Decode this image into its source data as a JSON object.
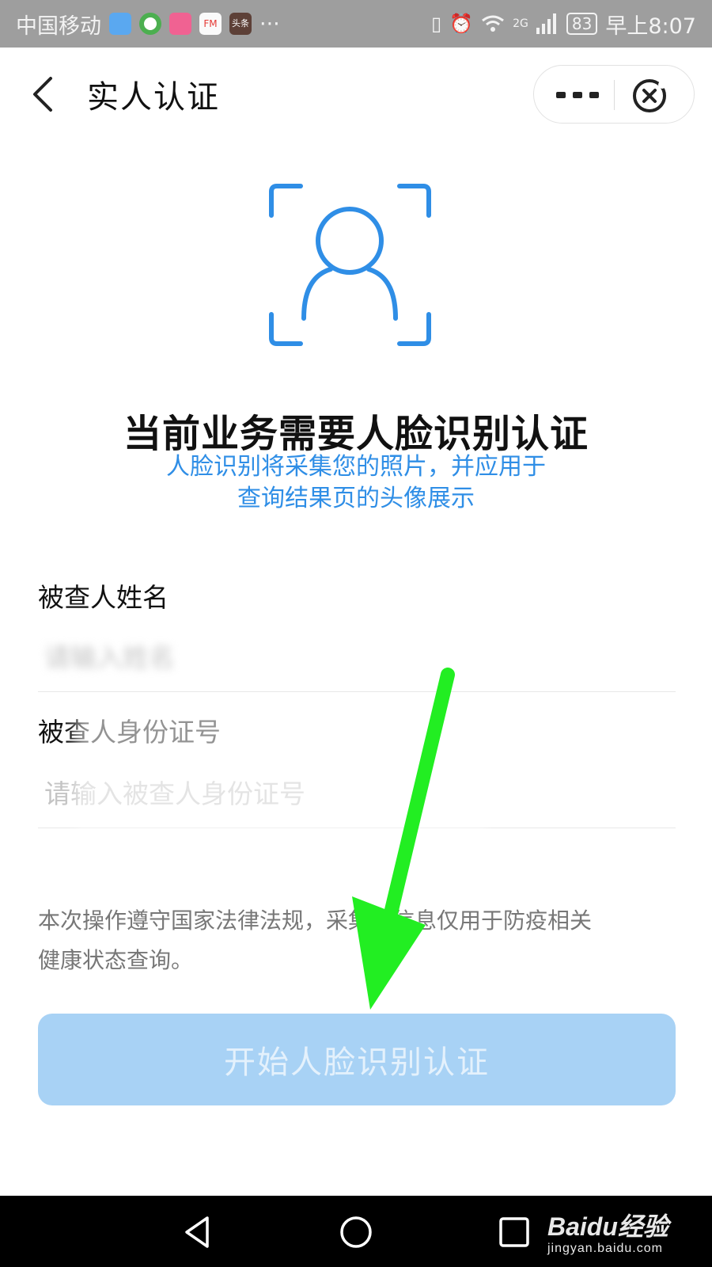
{
  "status_bar": {
    "carrier": "中国移动",
    "more": "···",
    "network": "2G",
    "battery": "83",
    "time": "早上8:07",
    "app_icons": [
      "app-icon-1",
      "app-icon-2",
      "app-icon-3",
      "fm-icon",
      "news-icon"
    ]
  },
  "header": {
    "title": "实人认证"
  },
  "face_section": {
    "title": "当前业务需要人脸识别认证",
    "subtitle_line1": "人脸识别将采集您的照片，并应用于",
    "subtitle_line2": "查询结果页的头像展示"
  },
  "form": {
    "name_label": "被查人姓名",
    "name_placeholder": "请输入姓名",
    "id_label": "被查人身份证号",
    "id_placeholder": "请输入被查人身份证号"
  },
  "notice_line1": "本次操作遵守国家法律法规，采集的信息仅用于防疫相关",
  "notice_line2": "健康状态查询。",
  "start_button_label": "开始人脸识别认证",
  "watermark": {
    "brand": "Baidu经验",
    "url": "jingyan.baidu.com"
  },
  "colors": {
    "accent": "#2f8ee6",
    "button_disabled": "#a8d2f5",
    "annotation_arrow": "#22ee22"
  }
}
